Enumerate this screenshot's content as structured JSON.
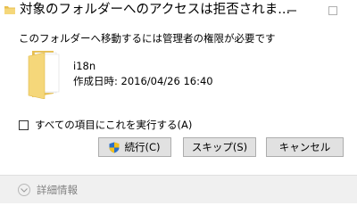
{
  "dialog": {
    "title": "対象のフォルダーへのアクセスは拒否されま...",
    "message": "このフォルダーへ移動するには管理者の権限が必要です"
  },
  "item": {
    "icon": "folder-icon",
    "name": "i18n",
    "created": "作成日時: 2016/04/26 16:40"
  },
  "options": {
    "apply_all_label": "すべての項目にこれを実行する(A)",
    "apply_all_checked": false
  },
  "buttons": {
    "continue_label": "続行(C)",
    "skip_label": "スキップ(S)",
    "cancel_label": "キャンセル"
  },
  "footer": {
    "details_label": "詳細情報"
  },
  "colors": {
    "folder_front": "#f5d77a",
    "folder_back": "#e8bf4d",
    "button_bg": "#e1e1e1",
    "footer_bg": "#f0f0f0"
  }
}
